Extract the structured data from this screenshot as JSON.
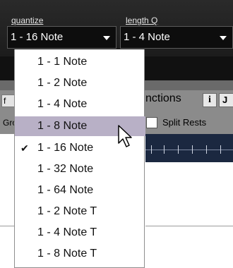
{
  "toolbar": {
    "quantize": {
      "label": "quantize",
      "value": "1 - 16 Note"
    },
    "length_q": {
      "label": "length Q",
      "value": "1 - 4 Note"
    }
  },
  "background": {
    "functions_label": "nctions",
    "info_button": "i",
    "j_button": "J",
    "split_rests_label": "Split Rests",
    "stub1": "f",
    "stub2": "Gro"
  },
  "menu": {
    "items": [
      {
        "label": "1 - 1 Note"
      },
      {
        "label": "1 - 2 Note"
      },
      {
        "label": "1 - 4 Note"
      },
      {
        "label": "1 - 8 Note",
        "highlighted": true
      },
      {
        "label": "1 - 16 Note",
        "checked": true
      },
      {
        "label": "1 - 32 Note"
      },
      {
        "label": "1 - 64 Note"
      },
      {
        "label": "1 - 2 Note T"
      },
      {
        "label": "1 - 4 Note T"
      },
      {
        "label": "1 - 8 Note T"
      }
    ],
    "check_glyph": "✔",
    "highlight_color": "#b8b0c6"
  }
}
